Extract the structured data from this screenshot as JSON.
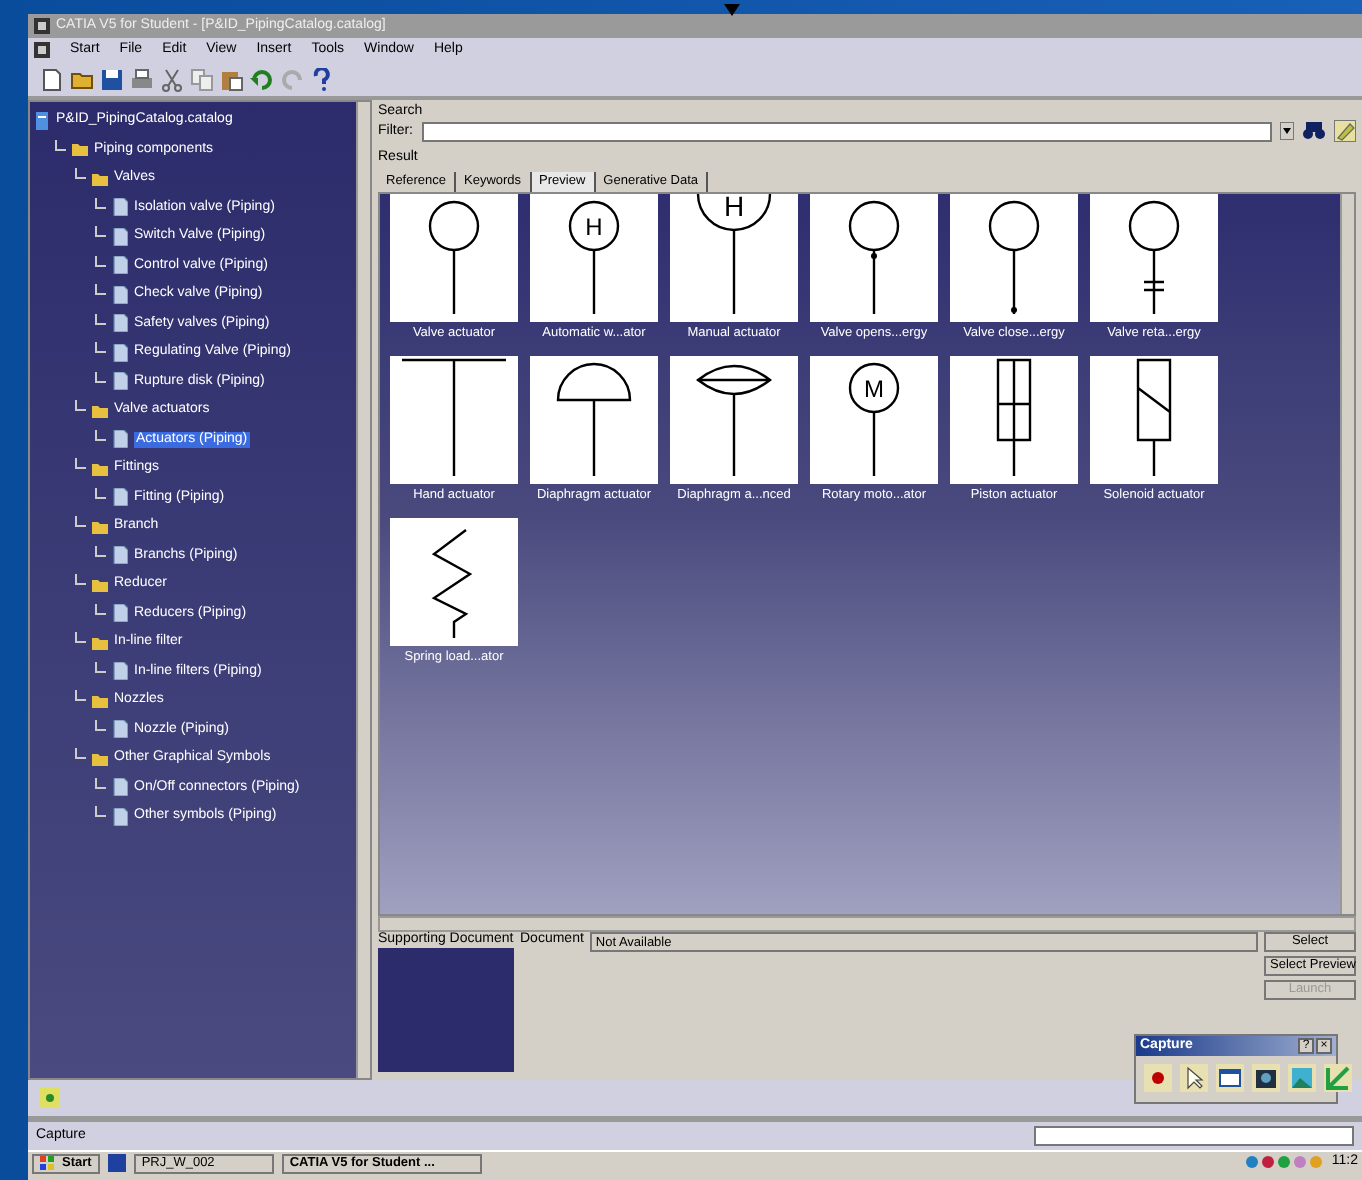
{
  "window": {
    "title": "CATIA V5 for Student - [P&ID_PipingCatalog.catalog]"
  },
  "menu": [
    "Start",
    "File",
    "Edit",
    "View",
    "Insert",
    "Tools",
    "Window",
    "Help"
  ],
  "tree": [
    {
      "label": "P&ID_PipingCatalog.catalog",
      "kind": "catalog",
      "selected": false,
      "children": [
        {
          "label": "Piping components",
          "kind": "folder",
          "selected": false,
          "children": [
            {
              "label": "Valves",
              "kind": "folder",
              "selected": false,
              "children": [
                {
                  "label": "Isolation valve (Piping)",
                  "kind": "chapter",
                  "selected": false
                },
                {
                  "label": "Switch Valve  (Piping)",
                  "kind": "chapter",
                  "selected": false
                },
                {
                  "label": "Control valve  (Piping)",
                  "kind": "chapter",
                  "selected": false
                },
                {
                  "label": "Check valve (Piping)",
                  "kind": "chapter",
                  "selected": false
                },
                {
                  "label": "Safety valves (Piping)",
                  "kind": "chapter",
                  "selected": false
                },
                {
                  "label": "Regulating Valve  (Piping)",
                  "kind": "chapter",
                  "selected": false
                },
                {
                  "label": "Rupture disk (Piping)",
                  "kind": "chapter",
                  "selected": false
                }
              ]
            },
            {
              "label": "Valve actuators",
              "kind": "folder",
              "selected": false,
              "children": [
                {
                  "label": "Actuators (Piping)",
                  "kind": "chapter",
                  "selected": true
                }
              ]
            },
            {
              "label": "Fittings",
              "kind": "folder",
              "selected": false,
              "children": [
                {
                  "label": "Fitting (Piping)",
                  "kind": "chapter",
                  "selected": false
                }
              ]
            },
            {
              "label": "Branch",
              "kind": "folder",
              "selected": false,
              "children": [
                {
                  "label": "Branchs (Piping)",
                  "kind": "chapter",
                  "selected": false
                }
              ]
            },
            {
              "label": "Reducer",
              "kind": "folder",
              "selected": false,
              "children": [
                {
                  "label": "Reducers (Piping)",
                  "kind": "chapter",
                  "selected": false
                }
              ]
            },
            {
              "label": "In-line filter",
              "kind": "folder",
              "selected": false,
              "children": [
                {
                  "label": "In-line filters (Piping)",
                  "kind": "chapter",
                  "selected": false
                }
              ]
            },
            {
              "label": "Nozzles",
              "kind": "folder",
              "selected": false,
              "children": [
                {
                  "label": "Nozzle (Piping)",
                  "kind": "chapter",
                  "selected": false
                }
              ]
            },
            {
              "label": "Other Graphical Symbols",
              "kind": "folder",
              "selected": false,
              "children": [
                {
                  "label": "On/Off connectors (Piping)",
                  "kind": "chapter",
                  "selected": false
                },
                {
                  "label": "Other symbols (Piping)",
                  "kind": "chapter",
                  "selected": false
                }
              ]
            }
          ]
        }
      ]
    }
  ],
  "search": {
    "section_label": "Search",
    "filter_label": "Filter:"
  },
  "result": {
    "section_label": "Result",
    "tabs": [
      {
        "label": "Reference",
        "selected": false
      },
      {
        "label": "Keywords",
        "selected": false
      },
      {
        "label": "Preview",
        "selected": true
      },
      {
        "label": "Generative Data",
        "selected": false
      }
    ],
    "items": [
      {
        "label": "Valve actuator",
        "kind": "circle"
      },
      {
        "label": "Automatic w...ator",
        "kind": "lettered",
        "letter": "H"
      },
      {
        "label": "Manual actuator",
        "kind": "big-lettered",
        "letter": "H"
      },
      {
        "label": "Valve opens...ergy",
        "kind": "dot-top"
      },
      {
        "label": "Valve close...ergy",
        "kind": "dot-bottom"
      },
      {
        "label": "Valve reta...ergy",
        "kind": "bars"
      },
      {
        "label": "Hand actuator",
        "kind": "tee"
      },
      {
        "label": "Diaphragm actuator",
        "kind": "dome"
      },
      {
        "label": "Diaphragm a...nced",
        "kind": "lens"
      },
      {
        "label": "Rotary moto...ator",
        "kind": "lettered",
        "letter": "M"
      },
      {
        "label": "Piston actuator",
        "kind": "piston"
      },
      {
        "label": "Solenoid actuator",
        "kind": "solenoid"
      },
      {
        "label": "Spring load...ator",
        "kind": "spring"
      }
    ]
  },
  "supporting": {
    "section_label": "Supporting Document",
    "document_label": "Document",
    "document_value": "Not Available"
  },
  "buttons": [
    {
      "label": "Select",
      "disabled": false
    },
    {
      "label": "Select Preview",
      "disabled": false
    },
    {
      "label": "Launch",
      "disabled": true
    }
  ],
  "capture_toolbar": {
    "title": "Capture",
    "help": "?",
    "close": "×"
  },
  "status_bar": {
    "text": "Capture"
  },
  "taskbar": {
    "start": "Start",
    "tasks": [
      "PRJ_W_002",
      "CATIA V5 for Student ..."
    ],
    "clock": "11:2"
  }
}
